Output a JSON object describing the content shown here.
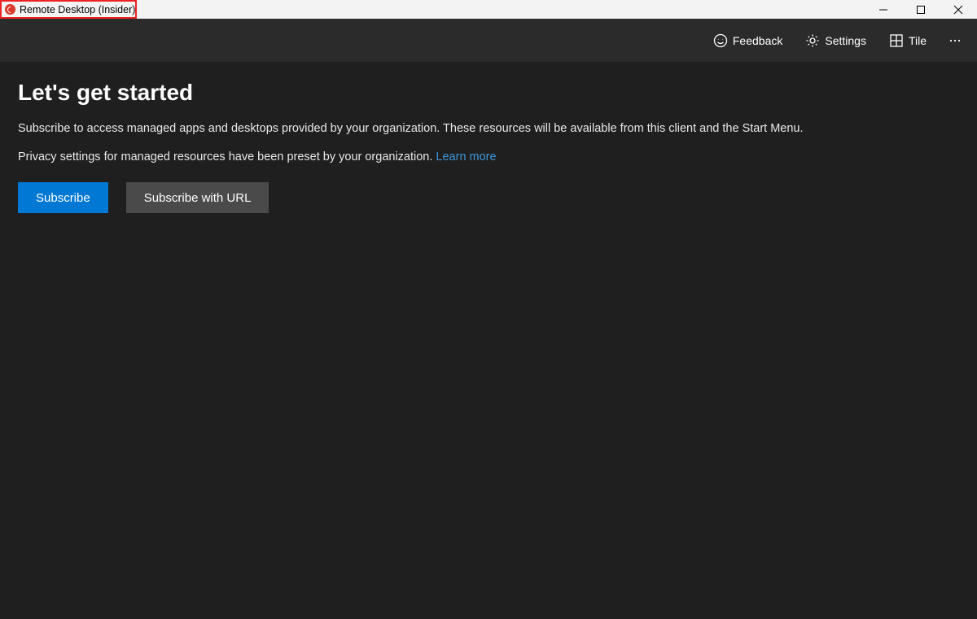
{
  "window": {
    "title": "Remote Desktop (Insider)"
  },
  "cmdbar": {
    "feedback": "Feedback",
    "settings": "Settings",
    "tile": "Tile"
  },
  "main": {
    "heading": "Let's get started",
    "p1": "Subscribe to access managed apps and desktops provided by your organization. These resources will be available from this client and the Start Menu.",
    "p2_prefix": "Privacy settings for managed resources have been preset by your organization. ",
    "learn_more": "Learn more",
    "subscribe": "Subscribe",
    "subscribe_url": "Subscribe with URL"
  }
}
